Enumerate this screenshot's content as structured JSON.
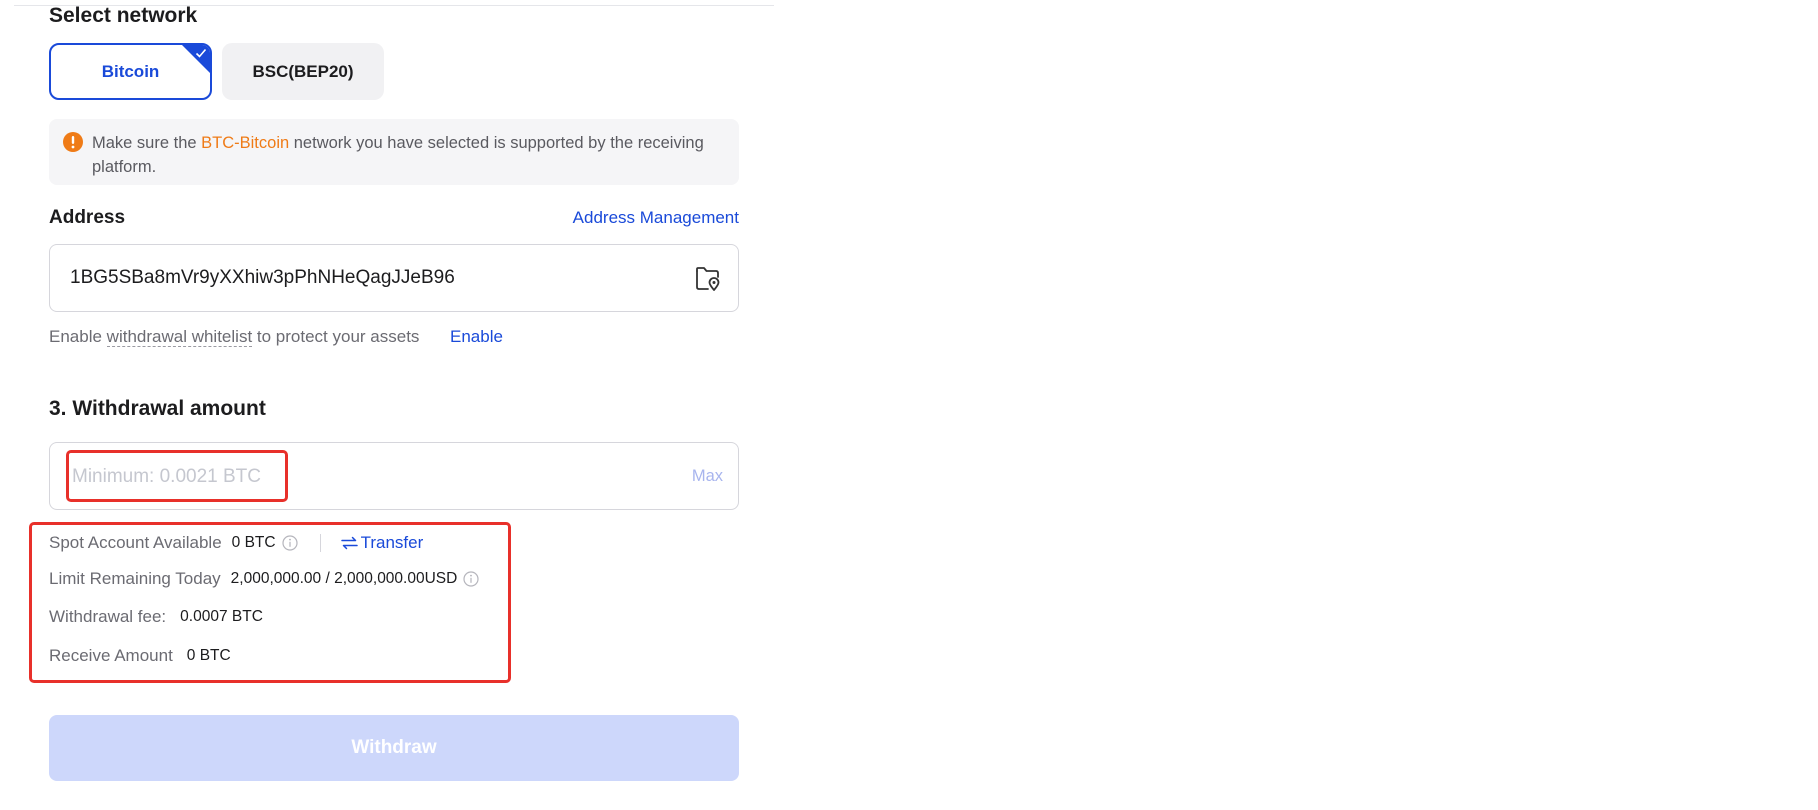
{
  "network": {
    "title": "Select network",
    "options": [
      {
        "label": "Bitcoin",
        "selected": true
      },
      {
        "label": "BSC(BEP20)",
        "selected": false
      }
    ],
    "notice": {
      "prefix": "Make sure the ",
      "highlight": "BTC-Bitcoin",
      "suffix": " network you have selected is supported by the receiving platform.",
      "highlight_color": "#ef7b17"
    }
  },
  "address": {
    "label": "Address",
    "management_link": "Address Management",
    "value": "1BG5SBa8mVr9yXXhiw3pPhNHeQagJJeB96",
    "whitelist_prefix": "Enable ",
    "whitelist_term": "withdrawal whitelist",
    "whitelist_suffix": " to protect your assets",
    "enable_link": "Enable"
  },
  "amount": {
    "title": "3. Withdrawal amount",
    "placeholder": "Minimum: 0.0021 BTC",
    "max_label": "Max"
  },
  "info": {
    "spot_label": "Spot Account Available",
    "spot_value": "0 BTC",
    "transfer_label": "Transfer",
    "limit_label": "Limit Remaining Today",
    "limit_value": "2,000,000.00 / 2,000,000.00USD",
    "fee_label": "Withdrawal fee:",
    "fee_value": "0.0007 BTC",
    "receive_label": "Receive Amount",
    "receive_value": "0 BTC"
  },
  "withdraw_button": "Withdraw",
  "colors": {
    "accent": "#1a4ad9",
    "highlight_box": "#e8302a",
    "button_disabled": "#cdd7fb"
  }
}
